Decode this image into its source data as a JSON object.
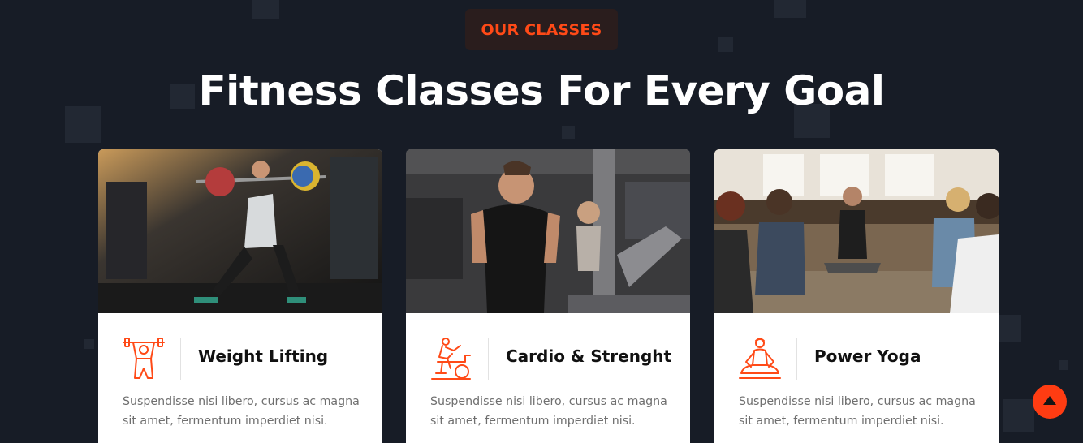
{
  "section": {
    "badge": "OUR CLASSES",
    "title": "Fitness Classes For Every Goal"
  },
  "colors": {
    "background": "#171c26",
    "accent": "#ff4a17",
    "card": "#ffffff"
  },
  "cards": [
    {
      "title": "Weight Lifting",
      "icon": "weightlifter-icon",
      "image": "woman-lifting-barbell-photo",
      "description": "Suspendisse nisi libero, cursus ac magna sit amet, fermentum imperdiet nisi."
    },
    {
      "title": "Cardio & Strenght",
      "icon": "exercise-bike-icon",
      "image": "man-running-treadmill-photo",
      "description": "Suspendisse nisi libero, cursus ac magna sit amet, fermentum imperdiet nisi."
    },
    {
      "title": "Power Yoga",
      "icon": "yoga-meditation-icon",
      "image": "yoga-class-photo",
      "description": "Suspendisse nisi libero, cursus ac magna sit amet, fermentum imperdiet nisi."
    }
  ],
  "scroll_top": {
    "icon": "arrow-up-icon"
  }
}
